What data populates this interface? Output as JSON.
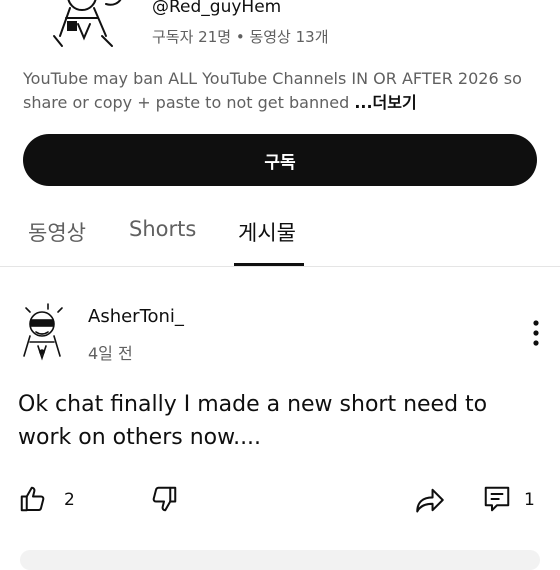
{
  "channel": {
    "handle": "@Red_guyHem",
    "meta": "구독자 21명 • 동영상 13개",
    "description": "YouTube may ban ALL YouTube Channels IN OR AFTER 2026 so share or copy + paste to not get banned ",
    "more_label": "...더보기"
  },
  "subscribe_label": "구독",
  "tabs": [
    {
      "label": "동영상",
      "active": false
    },
    {
      "label": "Shorts",
      "active": false
    },
    {
      "label": "게시물",
      "active": true
    }
  ],
  "post": {
    "author": "AsherToni_",
    "time": "4일 전",
    "text": "Ok chat finally I made a new short need to work on others now....",
    "likes": "2",
    "comments": "1"
  },
  "icons": {
    "like": "thumbs-up-icon",
    "dislike": "thumbs-down-icon",
    "share": "share-icon",
    "comment": "comment-icon",
    "menu": "more-vert-icon"
  }
}
